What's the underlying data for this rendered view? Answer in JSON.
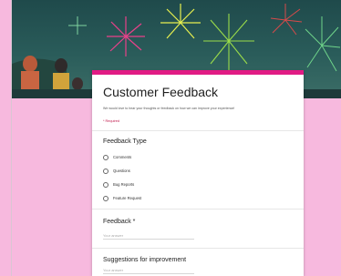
{
  "colors": {
    "page_bg": "#f7b9de",
    "accent": "#e11b84",
    "header_bg": "#2a5c5a"
  },
  "form": {
    "title": "Customer Feedback",
    "description": "We would love to hear your thoughts or feedback on how we can improve your experience!",
    "required_note": "* Required"
  },
  "questions": {
    "feedback_type": {
      "title": "Feedback Type",
      "options": [
        "Comments",
        "Questions",
        "Bug Reports",
        "Feature Request"
      ]
    },
    "feedback": {
      "title": "Feedback *",
      "placeholder": "Your answer"
    },
    "suggestions": {
      "title": "Suggestions for improvement",
      "placeholder": "Your answer"
    }
  },
  "header_image": {
    "icon": "fireworks-banner"
  }
}
